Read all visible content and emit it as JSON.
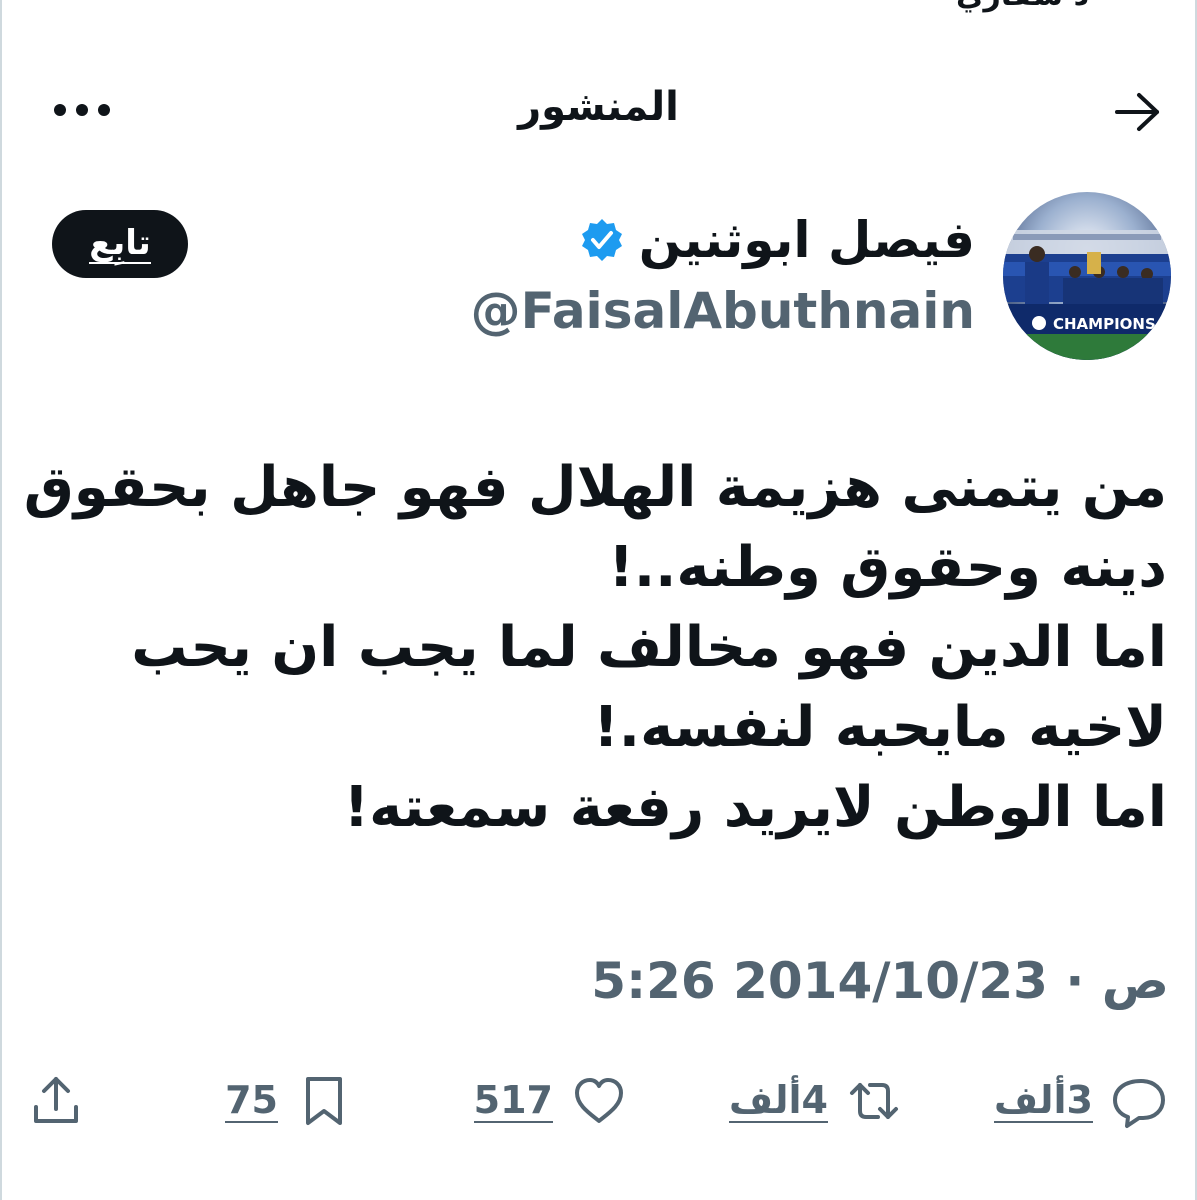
{
  "top_cut_text": "د سفاري",
  "header": {
    "title": "المنشور",
    "back_icon": "arrow-right-icon",
    "more_icon": "more-horizontal-icon"
  },
  "author": {
    "name": "فيصل ابوثنين",
    "handle": "@FaisalAbuthnain",
    "verified": true,
    "verified_color": "#1d9bf0",
    "avatar_caption": "CHAMPIONS"
  },
  "follow_button": {
    "label": "تابِع"
  },
  "tweet": {
    "lines": [
      "من يتمنى هزيمة الهلال فهو جاهل بحقوق",
      "دينه وحقوق وطنه..!",
      "اما الدين فهو مخالف لما يجب ان يحب",
      "لاخيه مايحبه لنفسه.!",
      "اما الوطن لايريد رفعة سمعته!"
    ],
    "timestamp": "5:26 ص · 2014/10/23"
  },
  "actions": {
    "replies": "3ألف",
    "retweets": "4ألف",
    "likes": "517",
    "bookmarks": "75"
  },
  "colors": {
    "text": "#0f1419",
    "secondary": "#536471",
    "accent": "#1d9bf0"
  }
}
